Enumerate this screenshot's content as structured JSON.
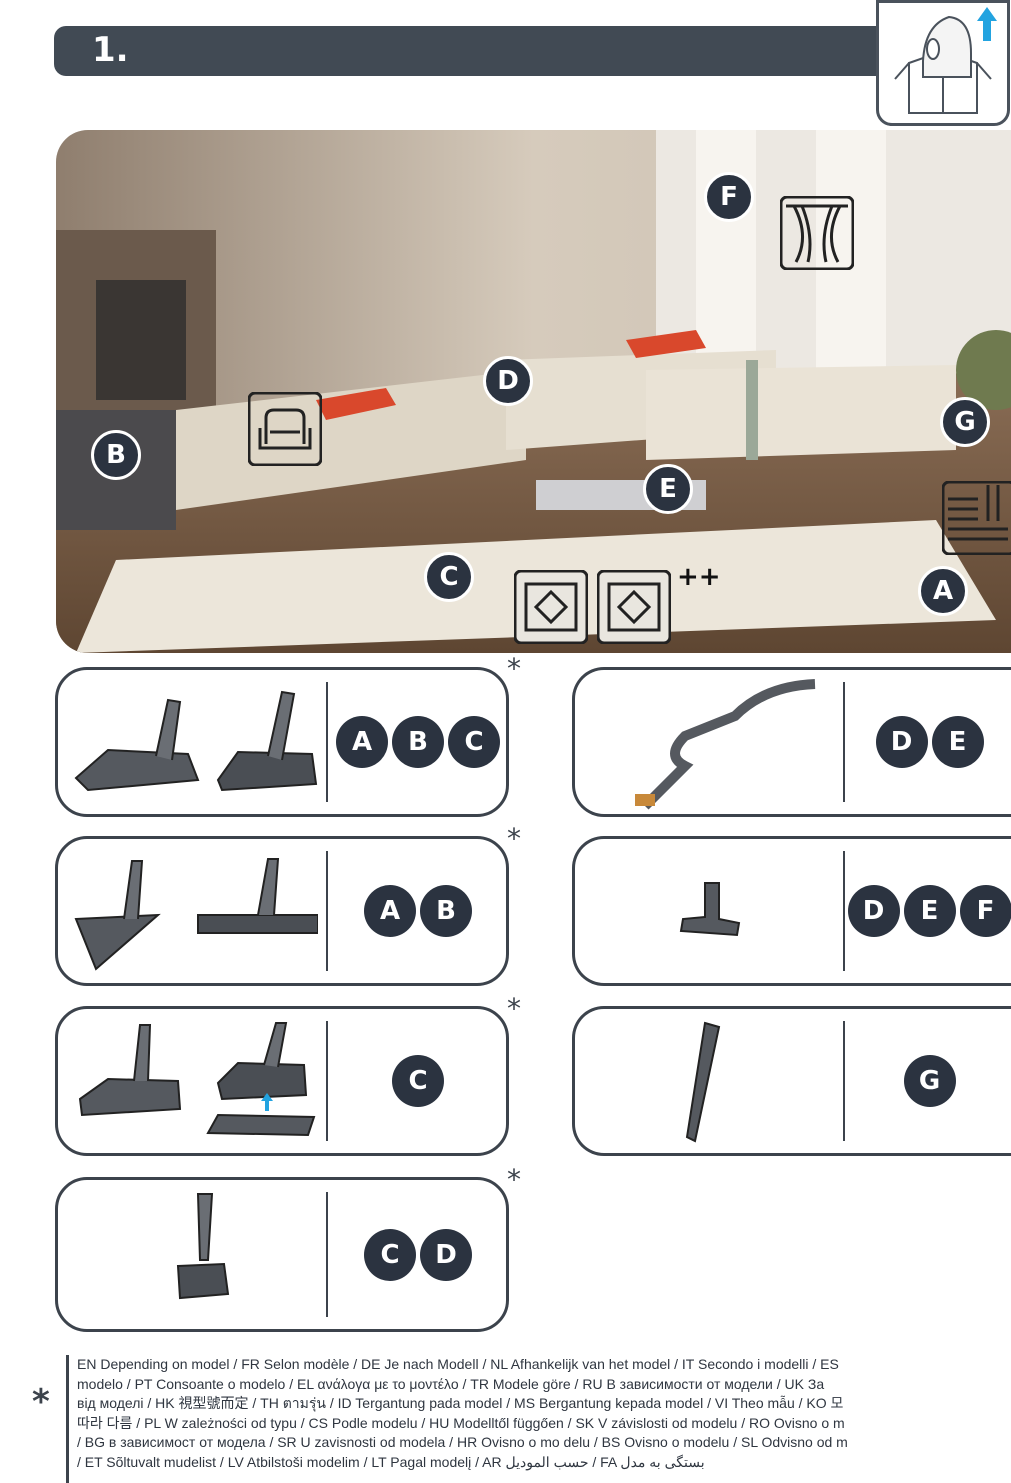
{
  "step": {
    "number": "1."
  },
  "room": {
    "labels": [
      "A",
      "B",
      "C",
      "D",
      "E",
      "F",
      "G"
    ],
    "carpet_plus": "++"
  },
  "panels": [
    {
      "letters": [
        "A",
        "B",
        "C"
      ],
      "asterisk": "*"
    },
    {
      "letters": [
        "D",
        "E"
      ]
    },
    {
      "letters": [
        "A",
        "B"
      ],
      "asterisk": "*"
    },
    {
      "letters": [
        "D",
        "E",
        "F"
      ]
    },
    {
      "letters": [
        "C"
      ],
      "asterisk": "*"
    },
    {
      "letters": [
        "G"
      ]
    },
    {
      "letters": [
        "C",
        "D"
      ],
      "asterisk": "*"
    }
  ],
  "footer": {
    "star": "*",
    "lines": [
      "EN Depending on model / FR Selon modèle / DE Je nach Modell / NL Afhankelijk van het model / IT Secondo i modelli / ES",
      "modelo / PT Consoante o modelo / EL ανάλογα με το μοντέλο / TR Modele göre / RU В зависимости от модели / UK За",
      "від моделі / HK 視型號而定 / TH ตามรุ่น / ID Tergantung pada model / MS Bergantung kepada model / VI Theo mẫu / KO 모",
      "따라 다름 / PL W zależności od typu / CS Podle modelu / HU Modelltől függően / SK V závislosti od modelu / RO Ovisno o m",
      "/ BG в зависимост от модела / SR U zavisnosti od modela / HR Ovisno o mo delu / BS Ovisno o modelu / SL Odvisno od m",
      "/ ET Sõltuvalt mudelist / LV Atbilstoši modelim / LT Pagal modelį / AR حسب الموديل / FA بستگی به مدل"
    ]
  }
}
